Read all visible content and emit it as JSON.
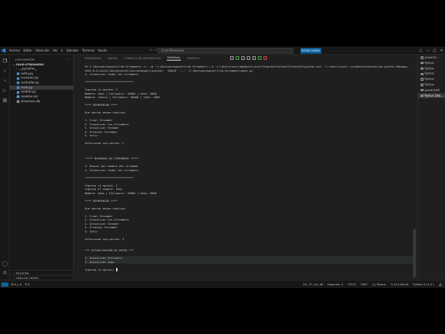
{
  "titlebar": {
    "menus": [
      "Archivo",
      "Editar",
      "Selección",
      "Ver",
      "Ir",
      "Ejecutar",
      "Terminal",
      "Ayuda"
    ],
    "search": "Crud-Streamers",
    "signin": "Iniciar sesión"
  },
  "sidebar": {
    "header": "EXPLORADOR",
    "folder": "CRUD-STREAMERS",
    "files": [
      {
        "name": "__pycache__",
        "type": "folder"
      },
      {
        "name": "authy.py",
        "type": "py"
      },
      {
        "name": "conexion.py",
        "type": "py"
      },
      {
        "name": "controller.py",
        "type": "py"
      },
      {
        "name": "main.py",
        "type": "py"
      },
      {
        "name": "models.py",
        "type": "py"
      },
      {
        "name": "readme.md",
        "type": "md"
      },
      {
        "name": "streamers.db",
        "type": "db"
      }
    ],
    "selected_index": 4,
    "bottom_outline": "ESQUEMA",
    "bottom_timeline": "LÍNEA DE TIEMPO"
  },
  "panel": {
    "tabs": [
      "PROBLEMAS",
      "SALIDA",
      "CONSOLA DE DEPURACIÓN",
      "TERMINAL",
      "PUERTOS"
    ],
    "active_tab": "TERMINAL"
  },
  "terminal": {
    "lines": [
      "PS C:\\Dev\\workspace\\Crud-Streamers> c:; cd 'c:\\Dev\\workspace\\Crud-Streamers'; & 'c:\\Users\\user\\AppData\\Local\\Programs\\Python\\Python312\\python.exe' 'c:\\Users\\user\\.vscode\\extensions\\ms-python.debugpy-",
      "2024.6.0-win32-x64\\bundled\\libs\\debugpy\\launcher' '59828' '--' 'C:\\Dev\\workspace\\Crud-Streamers\\main.py'",
      "2. Visualizar todos los streamers",
      "",
      "******************************",
      "",
      "Ingresa la opcion: 2",
      "Nombre: Ibai | Followers: 10000 | Subs: 5000",
      "Nombre: rubius | Followers: 50000 | Subs: 2000",
      "",
      "**** BIENVENIDO ****",
      "",
      "Que opcion desea realizar",
      "",
      "1. Crear Streamer",
      "2. Visualizar los Streamers",
      "3. Actualizar Steamer",
      "4. Eliminar Streamer",
      "5. Salir",
      "",
      "Seleccione una opción: 2",
      "",
      "",
      "",
      "***** BUSQUEDA DE STREAMERS *****",
      "",
      "1. Buscar por nombre del streamer",
      "2. Visualizar todos los streamers",
      "",
      "******************************",
      "",
      "Ingresa la opcion: 1",
      "Ingresa el nombre: Ibai",
      "Nombre: Ibai | Followers: 10000 | Subs: 5000",
      "",
      "**** BIENVENIDO ****",
      "",
      "Que opcion desea realizar",
      "",
      "1. Crear Streamer",
      "2. Visualizar los Streamers",
      "3. Actualizar Steamer",
      "4. Eliminar Streamer",
      "5. Salir",
      "",
      "Seleccione una opción: 3",
      "",
      "",
      "*** ACTUALIZACION DE DATOS ***",
      "",
      "1. Actualizar Followers",
      "2. Actualizar Subs",
      "",
      "Ingresa la opcion: "
    ]
  },
  "terminal_list": {
    "items": [
      "powersh...",
      "Python",
      "Python",
      "Python",
      "Python",
      "Python",
      "powershell",
      "Python Deb..."
    ],
    "active_index": 7
  },
  "status": {
    "left": [
      "⊗ 0 △ 0",
      "⚲ 0"
    ],
    "right": [
      "Lín. 17, col. 48",
      "Espacios: 4",
      "UTF-8",
      "CRLF",
      "{} Python",
      "3.12.4 64-bit",
      "Python 3.12.4 ("
    ]
  }
}
